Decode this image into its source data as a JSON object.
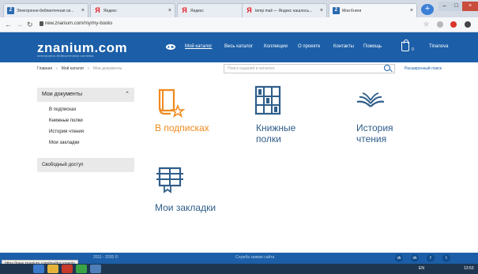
{
  "browser": {
    "tabs": [
      {
        "label": "Электронно-библиотечная си...",
        "favicon": "z"
      },
      {
        "label": "Яндекс",
        "favicon": "y"
      },
      {
        "label": "Яндекс",
        "favicon": "y"
      },
      {
        "label": "temp mail — Яндекс нашлось...",
        "favicon": "y"
      },
      {
        "label": "Мои Книги",
        "favicon": "z"
      }
    ],
    "url": "new.znanium.com/my/my-books"
  },
  "site": {
    "logo": "znanium.com",
    "logo_subtitle": "электронно-библиотечная система",
    "nav": [
      "Мой каталог",
      "Весь каталог",
      "Коллекции",
      "О проекте",
      "Контакты",
      "Помощь"
    ],
    "cart_count": "0",
    "username": "Tinanova",
    "accent_color": "#1c5fa8",
    "orange_color": "#f08a1e"
  },
  "breadcrumb": [
    "Главная",
    "Мой каталог",
    "Мои документы"
  ],
  "search": {
    "placeholder": "Поиск изданий в каталоге",
    "advanced_label": "Расширенный поиск"
  },
  "sidebar": {
    "header": "Мои документы",
    "items": [
      "В подписках",
      "Книжные полки",
      "История чтения",
      "Мои закладки"
    ],
    "free_access": "Свободный доступ"
  },
  "tiles": [
    {
      "label_line1": "В подписках",
      "label_line2": "",
      "icon": "book-star-icon"
    },
    {
      "label_line1": "Книжные",
      "label_line2": "полки",
      "icon": "bookshelf-icon"
    },
    {
      "label_line1": "История",
      "label_line2": "чтения",
      "icon": "open-book-icon"
    },
    {
      "label_line1": "Мои закладки",
      "label_line2": "",
      "icon": "bookmark-reader-icon"
    }
  ],
  "footer": {
    "copyright": "2011 - 2020 ©",
    "middle_text": "Служба заявки сайта",
    "status_url": "https://new.znanium.com/my/documents"
  },
  "taskbar": {
    "lang": "EN",
    "time": "13:53"
  }
}
